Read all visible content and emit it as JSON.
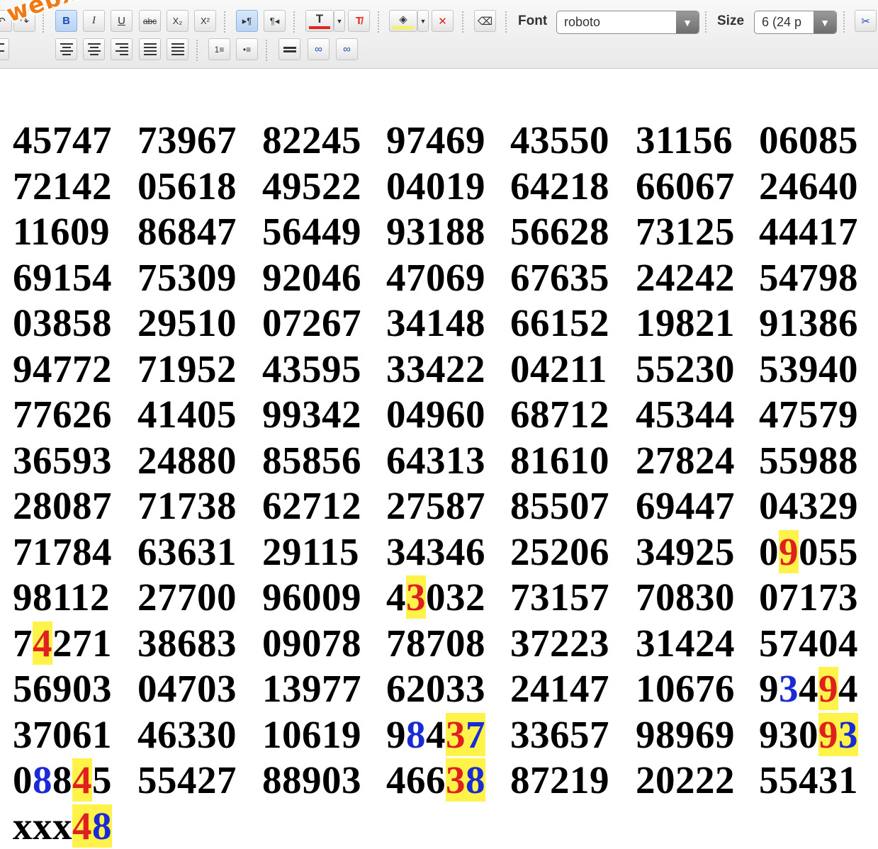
{
  "watermark": "webxoso.net",
  "toolbar": {
    "bold_label": "B",
    "italic_label": "I",
    "strike_label": "abc",
    "subscript_label": "X₂",
    "superscript_label": "X²",
    "font_label": "Font",
    "font_value": "roboto",
    "size_label": "Size",
    "size_value": "6 (24 p",
    "text_color": "#e3241b",
    "highlight_color": "#fff34a"
  },
  "grid": {
    "rows": [
      [
        "45747",
        "73967",
        "82245",
        "97469",
        "43550",
        "31156",
        "06085"
      ],
      [
        "72142",
        "05618",
        "49522",
        "04019",
        "64218",
        "66067",
        "24640"
      ],
      [
        "11609",
        "86847",
        "56449",
        "93188",
        "56628",
        "73125",
        "44417"
      ],
      [
        "69154",
        "75309",
        "92046",
        "47069",
        "67635",
        "24242",
        "54798"
      ],
      [
        "03858",
        "29510",
        "07267",
        "34148",
        "66152",
        "19821",
        "91386"
      ],
      [
        "94772",
        "71952",
        "43595",
        "33422",
        "04211",
        "55230",
        "53940"
      ],
      [
        "77626",
        "41405",
        "99342",
        "04960",
        "68712",
        "45344",
        "47579"
      ],
      [
        "36593",
        "24880",
        "85856",
        "64313",
        "81610",
        "27824",
        "55988"
      ],
      [
        "28087",
        "71738",
        "62712",
        "27587",
        "85507",
        "69447",
        "04329"
      ],
      [
        "71784",
        "63631",
        "29115",
        "34346",
        "25206",
        "34925",
        "09055"
      ],
      [
        "98112",
        "27700",
        "96009",
        "43032",
        "73157",
        "70830",
        "07173"
      ],
      [
        "74271",
        "38683",
        "09078",
        "78708",
        "37223",
        "31424",
        "57404"
      ],
      [
        "56903",
        "04703",
        "13977",
        "62033",
        "24147",
        "10676",
        "93494"
      ],
      [
        "37061",
        "46330",
        "10619",
        "98437",
        "33657",
        "98969",
        "93093"
      ],
      [
        "08845",
        "55427",
        "88903",
        "46638",
        "87219",
        "20222",
        "55431"
      ],
      [
        "xxx48"
      ]
    ],
    "highlights": [
      {
        "row": 9,
        "col": 6,
        "marks": "-y---"
      },
      {
        "row": 10,
        "col": 3,
        "marks": "-y---"
      },
      {
        "row": 11,
        "col": 0,
        "marks": "-y---"
      },
      {
        "row": 12,
        "col": 6,
        "marks": "-b-y-"
      },
      {
        "row": 13,
        "col": 3,
        "marks": "-b-yb"
      },
      {
        "row": 13,
        "col": 6,
        "marks": "---yb"
      },
      {
        "row": 14,
        "col": 0,
        "marks": "-b-y-"
      },
      {
        "row": 14,
        "col": 3,
        "marks": "---yb"
      },
      {
        "row": 15,
        "col": 0,
        "marks": "---yb"
      }
    ],
    "marker_colors": {
      "highlight_bg": "#fff34a",
      "highlight_text": "#e0201f",
      "blue_text": "#1a2bd6"
    }
  }
}
